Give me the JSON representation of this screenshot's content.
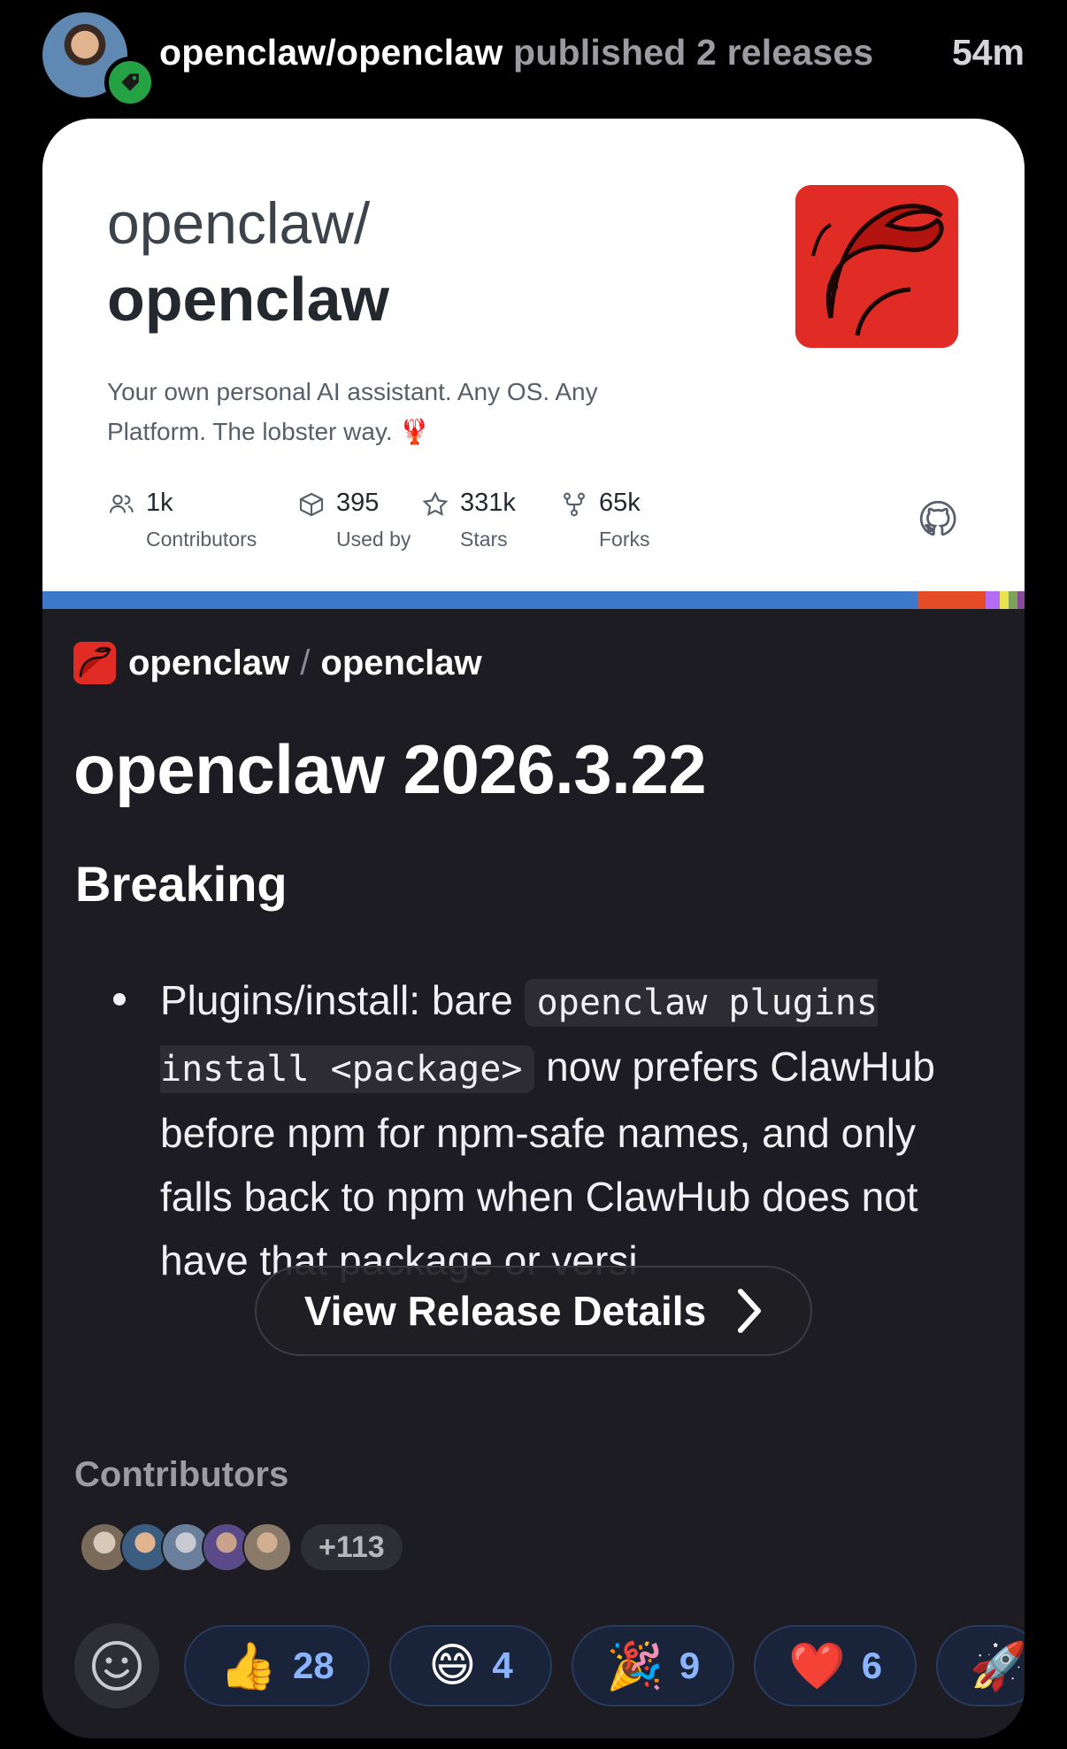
{
  "header": {
    "repo": "openclaw/openclaw",
    "action": "published 2 releases",
    "time": "54m"
  },
  "og_card": {
    "owner": "openclaw/",
    "repo": "openclaw",
    "description": "Your own personal AI assistant. Any OS. Any Platform. The lobster way. 🦞",
    "stats": [
      {
        "value": "1k",
        "label": "Contributors",
        "icon": "people-icon"
      },
      {
        "value": "395",
        "label": "Used by",
        "icon": "package-icon"
      },
      {
        "value": "331k",
        "label": "Stars",
        "icon": "star-icon"
      },
      {
        "value": "65k",
        "label": "Forks",
        "icon": "fork-icon"
      }
    ],
    "language_colors": [
      "#3178c6",
      "#e34c26",
      "#b36cf2",
      "#e8e34d",
      "#5a7a3a",
      "#8a4a9b"
    ]
  },
  "release": {
    "owner": "openclaw",
    "separator": "/",
    "repo": "openclaw",
    "title": "openclaw 2026.3.22",
    "section": "Breaking",
    "bullet": {
      "pre": "Plugins/install: bare ",
      "code": "openclaw plugins install <package>",
      "post": " now prefers ClawHub before npm for npm-safe names, and only falls back to npm when ClawHub does not have that package or versi"
    },
    "view_button": "View Release Details"
  },
  "contributors": {
    "heading": "Contributors",
    "more": "+113",
    "avatar_colors": [
      "#7a6a5a",
      "#3c5d80",
      "#6a7f9c",
      "#5a4a8a",
      "#8a7a6a"
    ]
  },
  "reactions": [
    {
      "emoji": "👍",
      "count": "28"
    },
    {
      "emoji": "😄",
      "count": "4"
    },
    {
      "emoji": "🎉",
      "count": "9"
    },
    {
      "emoji": "❤️",
      "count": "6"
    },
    {
      "emoji": "🚀",
      "count": ""
    }
  ]
}
